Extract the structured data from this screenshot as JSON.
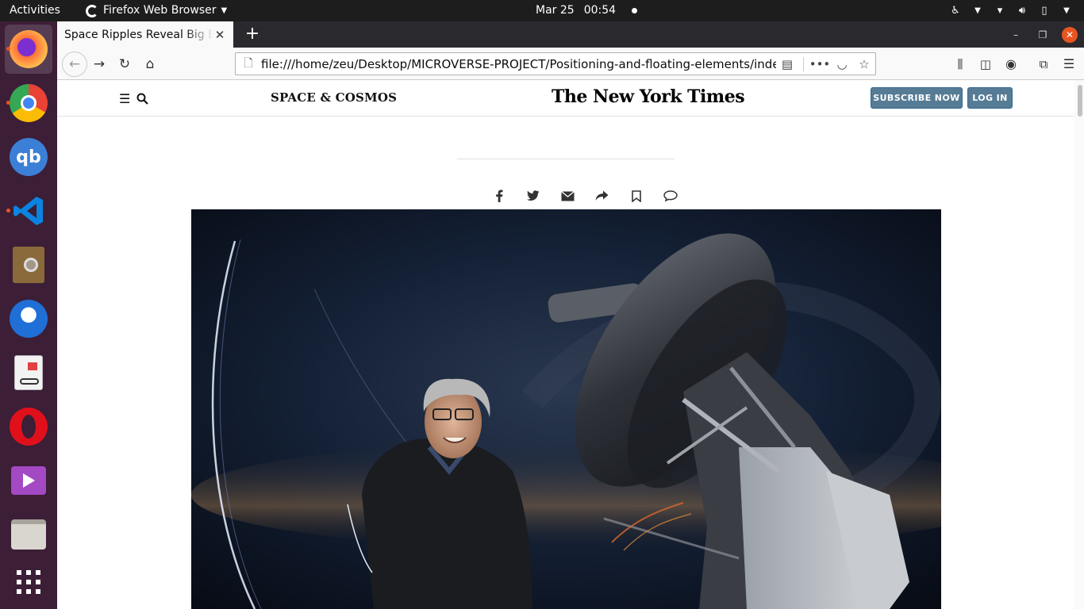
{
  "topbar": {
    "activities": "Activities",
    "app_name": "Firefox Web Browser",
    "date": "Mar 25",
    "time": "00:54"
  },
  "dock": {
    "items": [
      {
        "name": "firefox-icon",
        "color": "#ff7139"
      },
      {
        "name": "chrome-icon",
        "color": "#4285f4"
      },
      {
        "name": "qbittorrent-icon",
        "label": "qb",
        "color": "#3c7fd6"
      },
      {
        "name": "vscode-icon",
        "color": "#0078d4"
      },
      {
        "name": "document-viewer-icon",
        "color": "#b08a4a"
      },
      {
        "name": "thunderbird-icon",
        "color": "#1f6fd6"
      },
      {
        "name": "text-reader-icon",
        "color": "#e0e0e0"
      },
      {
        "name": "opera-icon",
        "color": "#e0101b"
      },
      {
        "name": "media-player-icon",
        "color": "#a349c4"
      },
      {
        "name": "files-icon",
        "color": "#d9d6d0"
      },
      {
        "name": "show-applications-icon",
        "color": "#ffffff"
      }
    ]
  },
  "browser": {
    "tab_title": "Space Ripples Reveal Big Ba",
    "url": "file:///home/zeu/Desktop/MICROVERSE-PROJECT/Positioning-and-floating-elements/index.h"
  },
  "page": {
    "section": "SPACE & COSMOS",
    "logo": "The New York Times",
    "subscribe_label": "SUBSCRIBE NOW",
    "login_label": "LOG IN"
  },
  "colors": {
    "topbar": "#1d1d1d",
    "dock": "#3c1e37",
    "accent": "#e95420",
    "header_button": "#567b95"
  }
}
